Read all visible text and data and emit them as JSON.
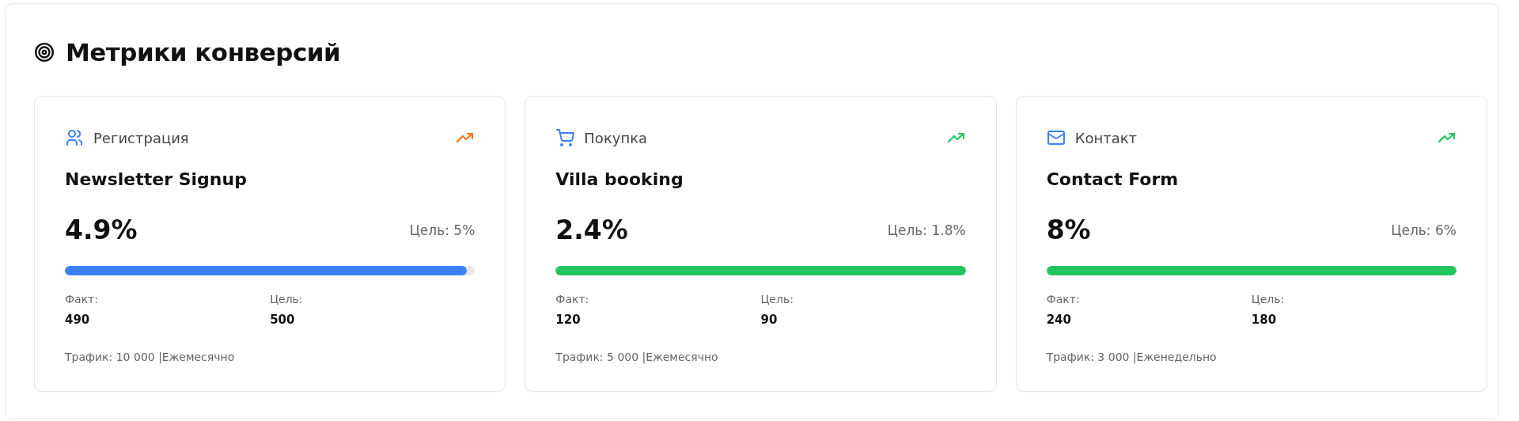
{
  "title": "Метрики конверсий",
  "cards": [
    {
      "kind": "users",
      "category": "Регистрация",
      "trend": {
        "color": "#f97316"
      },
      "name": "Newsletter Signup",
      "rate": "4.9%",
      "goal": "Цель: 5%",
      "level": 0.98,
      "color": "#3b82f6",
      "fact_label": "Факт:",
      "fact": "490",
      "target_label": "Цель:",
      "target": "500",
      "footer": "Трафик: 10 000 |Ежемесячно"
    },
    {
      "kind": "cart",
      "category": "Покупка",
      "trend": {
        "color": "#22c55e"
      },
      "name": "Villa booking",
      "rate": "2.4%",
      "goal": "Цель: 1.8%",
      "level": 1,
      "color": "#22c55e",
      "fact_label": "Факт:",
      "fact": "120",
      "target_label": "Цель:",
      "target": "90",
      "footer": "Трафик: 5 000 |Ежемесячно"
    },
    {
      "kind": "mail",
      "category": "Контакт",
      "trend": {
        "color": "#22c55e"
      },
      "name": "Contact Form",
      "rate": "8%",
      "goal": "Цель: 6%",
      "level": 1,
      "color": "#22c55e",
      "fact_label": "Факт:",
      "fact": "240",
      "target_label": "Цель:",
      "target": "180",
      "footer": "Трафик: 3 000 |Еженедельно"
    }
  ]
}
